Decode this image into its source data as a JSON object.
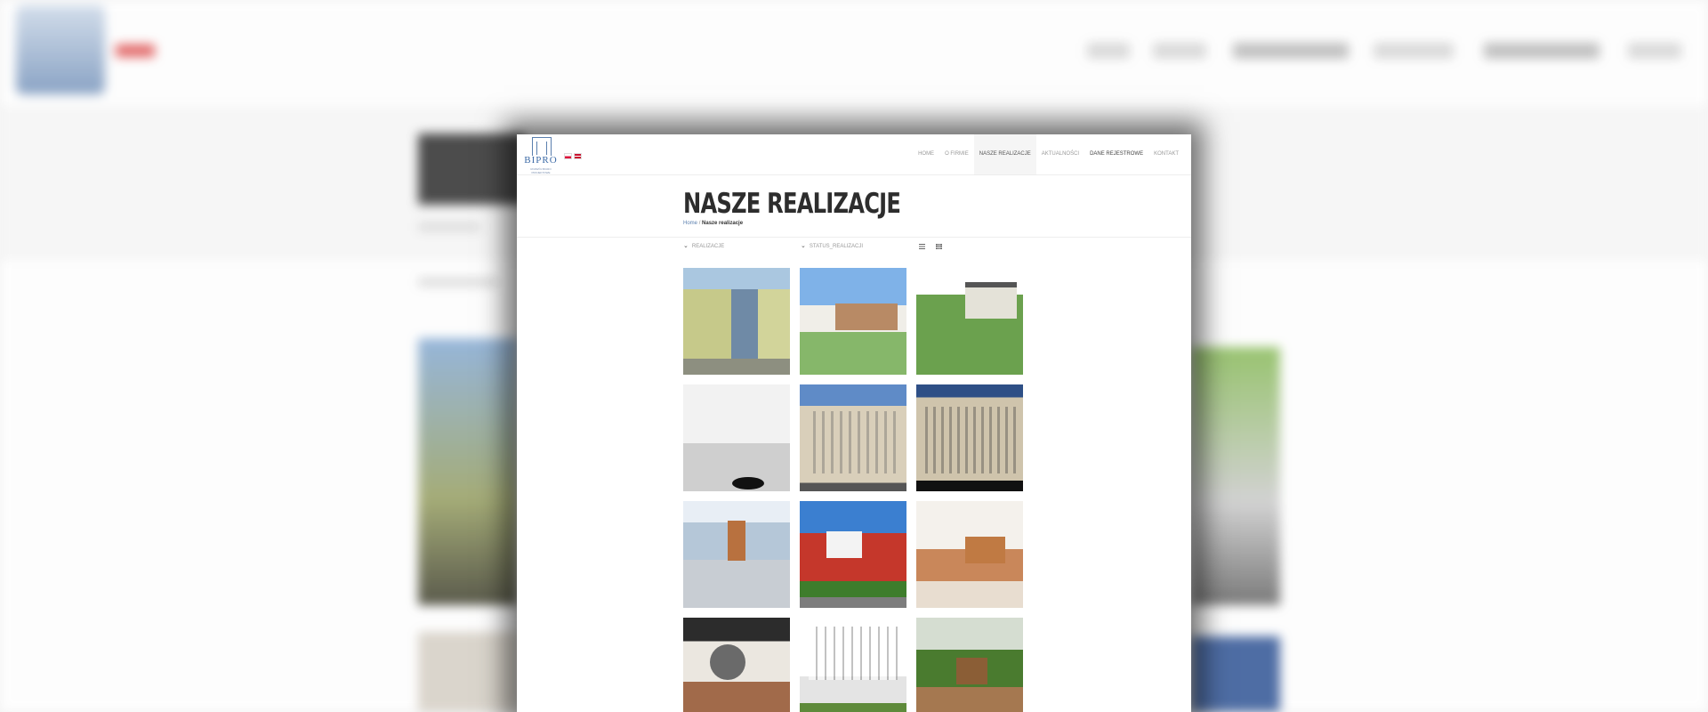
{
  "header": {
    "logo_text": "BIPRO",
    "logo_subtext": "ROZWÓJ BIURO PROJEKTOWE",
    "languages": [
      "pl",
      "en"
    ],
    "nav": [
      {
        "label": "HOME",
        "active": false
      },
      {
        "label": "O FIRMIE",
        "active": false
      },
      {
        "label": "NASZE REALIZACJE",
        "active": true
      },
      {
        "label": "AKTUALNOŚCI",
        "active": false
      },
      {
        "label": "DANE REJESTROWE",
        "active": false
      },
      {
        "label": "KONTAKT",
        "active": false
      }
    ]
  },
  "page": {
    "title": "NASZE REALIZACJE",
    "breadcrumb": {
      "home": "Home",
      "separator": "/",
      "current": "Nasze realizacje"
    }
  },
  "filters": {
    "realizacje": "REALIZACJE",
    "status": "STATUS_REALIZACJI"
  },
  "gallery": {
    "columns": 3,
    "items": [
      {
        "subject": "office building with glass facade"
      },
      {
        "subject": "townhouses with plaza"
      },
      {
        "subject": "housing estate aerial render"
      },
      {
        "subject": "modern interior hall"
      },
      {
        "subject": "historic tenement front"
      },
      {
        "subject": "historic tenement dark"
      },
      {
        "subject": "glass pavilion with pedestrians"
      },
      {
        "subject": "red houses with trees"
      },
      {
        "subject": "atrium interior"
      },
      {
        "subject": "industrial loft interior"
      },
      {
        "subject": "white apartment block courtyard"
      },
      {
        "subject": "playground in green courtyard"
      }
    ]
  },
  "icons": {
    "filter_chevron": "chevron-down-icon",
    "view_list": "list-view-icon",
    "view_grid": "grid-view-icon"
  },
  "colors": {
    "accent": "#5a7fae",
    "title": "#2d2d2d",
    "nav_text": "#9a9a9a"
  }
}
